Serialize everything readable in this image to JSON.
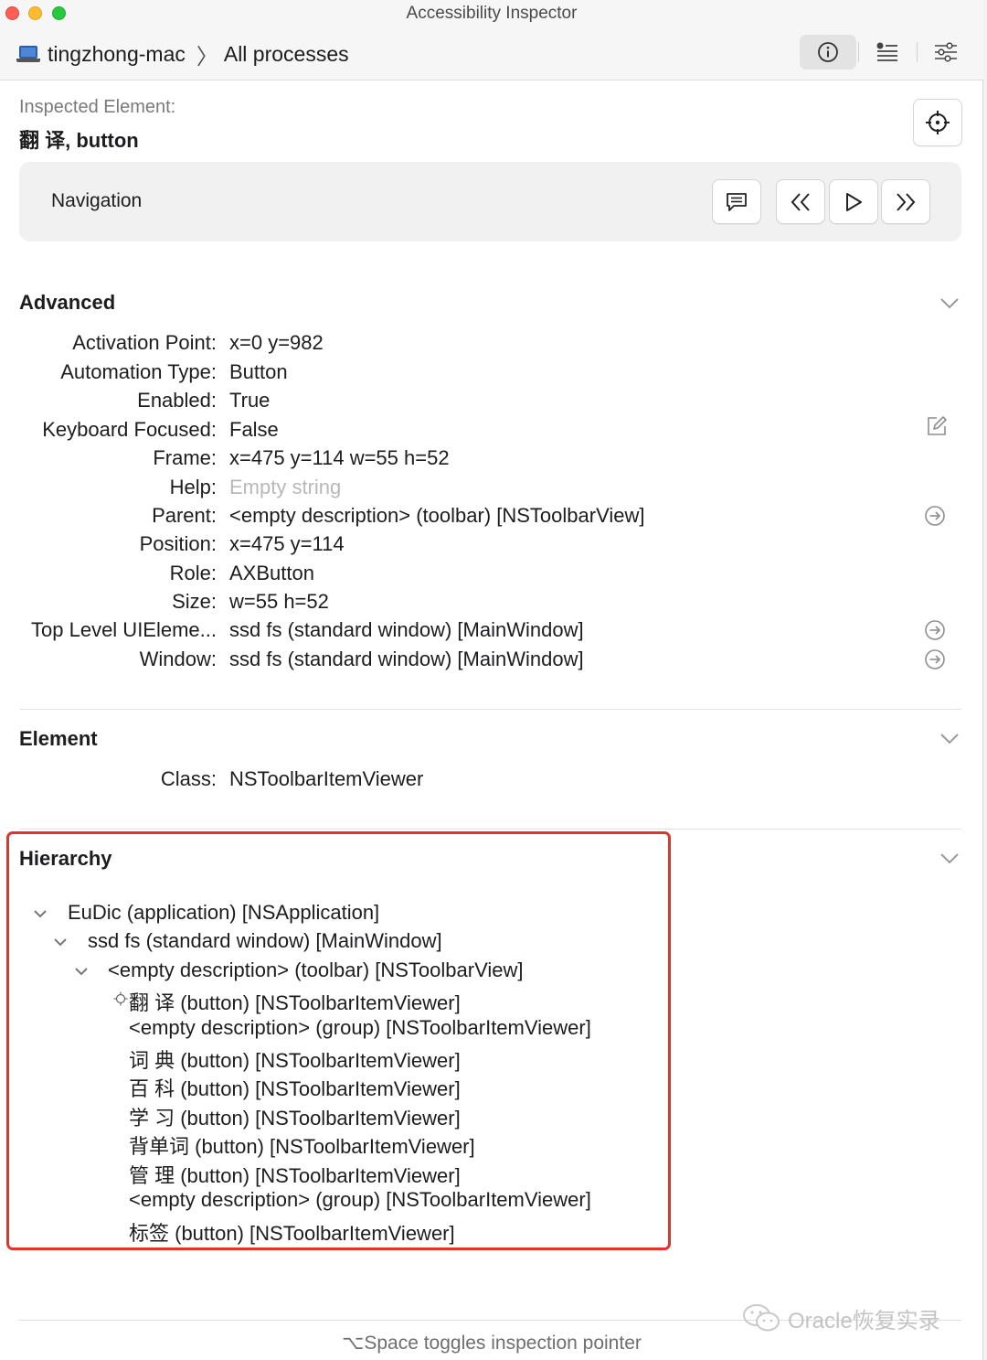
{
  "window": {
    "title": "Accessibility Inspector"
  },
  "toolbar": {
    "target_host": "tingzhong-mac",
    "target_scope": "All processes",
    "icons": [
      "info-icon",
      "list-icon",
      "sliders-icon"
    ]
  },
  "inspected": {
    "label": "Inspected Element:",
    "value": "翻 译, button"
  },
  "navigation": {
    "label": "Navigation",
    "icons": [
      "speech-bubble-icon",
      "double-chevron-left-icon",
      "play-icon",
      "double-chevron-right-icon"
    ]
  },
  "advanced": {
    "title": "Advanced",
    "rows": [
      {
        "key": "Activation Point:",
        "value": "x=0 y=982"
      },
      {
        "key": "Automation Type:",
        "value": "Button"
      },
      {
        "key": "Enabled:",
        "value": "True"
      },
      {
        "key": "Keyboard Focused:",
        "value": "False"
      },
      {
        "key": "Frame:",
        "value": "x=475 y=114 w=55 h=52"
      },
      {
        "key": "Help:",
        "value": "Empty string"
      },
      {
        "key": "Parent:",
        "value": "<empty description> (toolbar) [NSToolbarView]"
      },
      {
        "key": "Position:",
        "value": "x=475 y=114"
      },
      {
        "key": "Role:",
        "value": "AXButton"
      },
      {
        "key": "Size:",
        "value": "w=55 h=52"
      },
      {
        "key": "Top Level UIEleme...",
        "value": "ssd fs (standard window) [MainWindow]"
      },
      {
        "key": "Window:",
        "value": "ssd fs (standard window) [MainWindow]"
      }
    ]
  },
  "element": {
    "title": "Element",
    "rows": [
      {
        "key": "Class:",
        "value": "NSToolbarItemViewer"
      }
    ]
  },
  "hierarchy": {
    "title": "Hierarchy",
    "items": [
      {
        "label": "EuDic (application) [NSApplication]"
      },
      {
        "label": "ssd fs (standard window) [MainWindow]"
      },
      {
        "label": "<empty description> (toolbar) [NSToolbarView]"
      },
      {
        "label": "翻 译 (button) [NSToolbarItemViewer]"
      },
      {
        "label": "<empty description> (group) [NSToolbarItemViewer]"
      },
      {
        "label": "词 典 (button) [NSToolbarItemViewer]"
      },
      {
        "label": "百 科 (button) [NSToolbarItemViewer]"
      },
      {
        "label": "学 习 (button) [NSToolbarItemViewer]"
      },
      {
        "label": "背单词 (button) [NSToolbarItemViewer]"
      },
      {
        "label": "管 理 (button) [NSToolbarItemViewer]"
      },
      {
        "label": "<empty description> (group) [NSToolbarItemViewer]"
      },
      {
        "label": "标签 (button) [NSToolbarItemViewer]"
      }
    ]
  },
  "footer": {
    "hint": "⌥Space toggles inspection pointer"
  },
  "watermark": {
    "text": "Oracle恢复实录"
  },
  "colors": {
    "highlight": "#e0352b",
    "close": "#ff5f57",
    "minimize": "#febc2e",
    "maximize": "#28c840"
  }
}
